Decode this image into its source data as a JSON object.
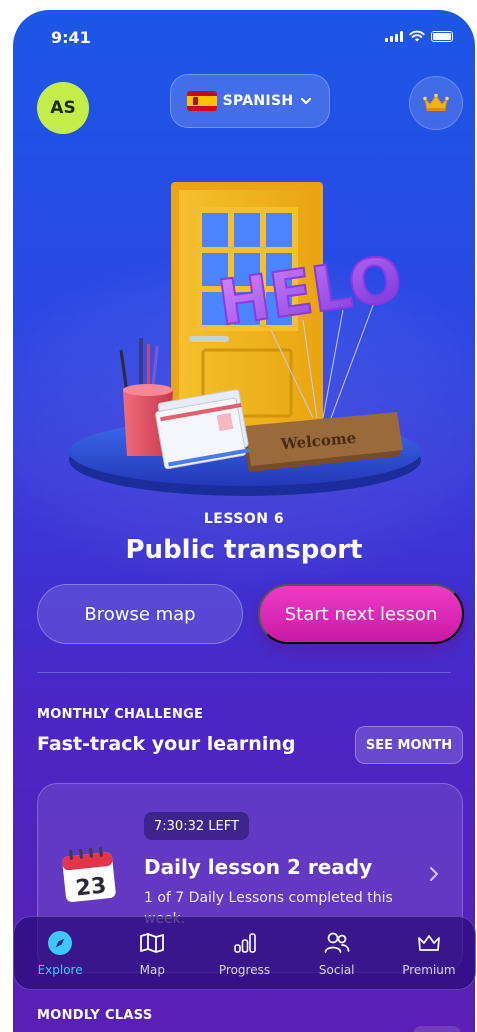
{
  "status_bar": {
    "time": "9:41"
  },
  "header": {
    "avatar_initials": "AS",
    "language_label": "SPANISH",
    "crown_icon": "crown-icon"
  },
  "lesson": {
    "kicker": "LESSON 6",
    "title": "Public transport",
    "balloon_text": "HELO",
    "doormat_text": "Welcome"
  },
  "actions": {
    "browse_label": "Browse map",
    "start_label": "Start next lesson"
  },
  "monthly_challenge": {
    "kicker": "MONTHLY CHALLENGE",
    "title": "Fast-track your learning",
    "see_month_label": "SEE MONTH"
  },
  "daily_card": {
    "time_left": "7:30:32 LEFT",
    "title": "Daily lesson 2 ready",
    "subtitle": "1 of 7 Daily Lessons completed this week.",
    "calendar_day": "23"
  },
  "tabbar": {
    "items": [
      {
        "label": "Explore",
        "icon": "compass-icon",
        "active": true
      },
      {
        "label": "Map",
        "icon": "map-icon",
        "active": false
      },
      {
        "label": "Progress",
        "icon": "bar-chart-icon",
        "active": false
      },
      {
        "label": "Social",
        "icon": "people-icon",
        "active": false
      },
      {
        "label": "Premium",
        "icon": "crown-icon",
        "active": false
      }
    ]
  },
  "next_section": {
    "kicker": "MONDLY CLASS"
  },
  "colors": {
    "accent_magenta": "#e030c0",
    "avatar_green": "#c3ee4a",
    "active_tab_blue": "#3fc8ff",
    "background_top": "#1c57e6",
    "background_bottom": "#5a1fb4"
  }
}
